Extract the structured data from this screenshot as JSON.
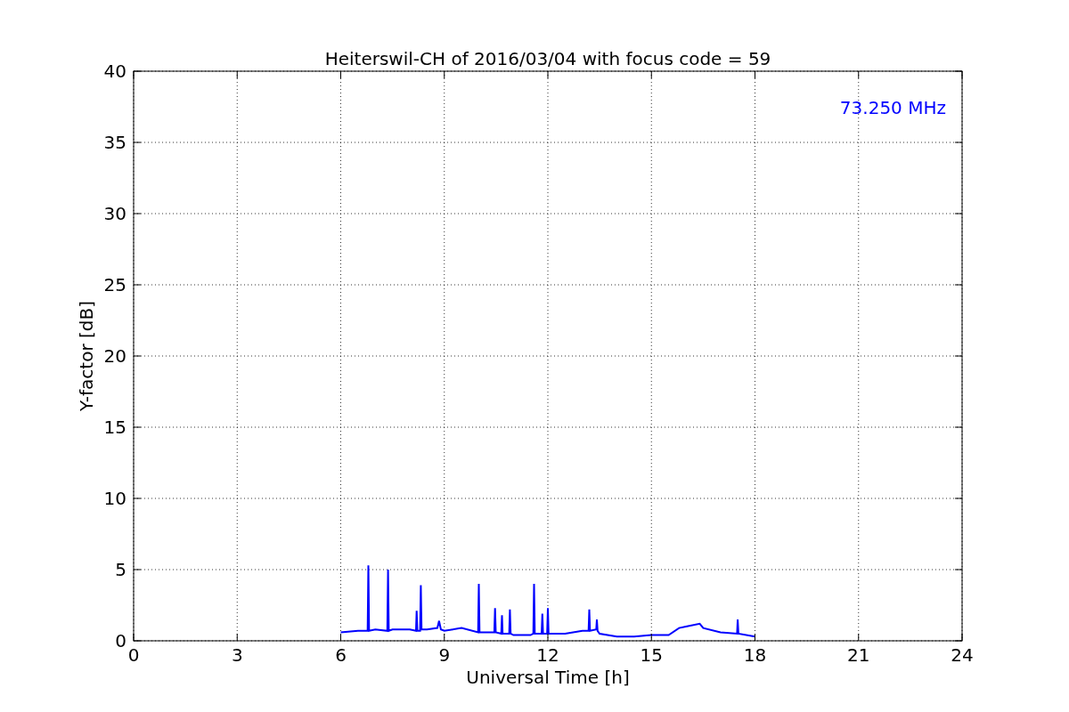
{
  "chart_data": {
    "type": "line",
    "title": "Heiterswil-CH of 2016/03/04 with focus code = 59",
    "xlabel": "Universal Time [h]",
    "ylabel": "Y-factor [dB]",
    "x": [
      6,
      6.5,
      6.78,
      6.8,
      6.82,
      7,
      7.35,
      7.37,
      7.39,
      7.5,
      8,
      8.18,
      8.2,
      8.22,
      8.3,
      8.32,
      8.34,
      8.5,
      8.8,
      8.85,
      8.9,
      9,
      9.5,
      9.98,
      10,
      10.02,
      10.45,
      10.47,
      10.49,
      10.65,
      10.67,
      10.69,
      10.88,
      10.9,
      10.92,
      11,
      11.5,
      11.58,
      11.6,
      11.62,
      11.82,
      11.84,
      11.86,
      11.98,
      12,
      12.02,
      12.5,
      13,
      13.18,
      13.2,
      13.22,
      13.4,
      13.42,
      13.44,
      13.5,
      14,
      14.5,
      15,
      15.5,
      15.8,
      16,
      16.4,
      16.5,
      17,
      17.48,
      17.5,
      17.52,
      18
    ],
    "series": [
      {
        "name": "73.250 MHz",
        "color": "#0000ff",
        "values": [
          0.6,
          0.7,
          0.7,
          5.3,
          0.7,
          0.8,
          0.7,
          5.0,
          0.7,
          0.8,
          0.8,
          0.7,
          2.1,
          0.7,
          0.7,
          3.9,
          0.8,
          0.8,
          0.9,
          1.4,
          0.8,
          0.7,
          0.9,
          0.6,
          4.0,
          0.6,
          0.6,
          2.3,
          0.6,
          0.5,
          1.8,
          0.5,
          0.5,
          2.2,
          0.5,
          0.4,
          0.4,
          0.5,
          4.0,
          0.5,
          0.5,
          1.9,
          0.5,
          0.5,
          2.3,
          0.5,
          0.5,
          0.7,
          0.7,
          2.2,
          0.7,
          0.8,
          1.5,
          0.7,
          0.5,
          0.3,
          0.3,
          0.4,
          0.4,
          0.9,
          1.0,
          1.2,
          0.9,
          0.6,
          0.5,
          1.5,
          0.5,
          0.3
        ]
      }
    ],
    "xlim": [
      0,
      24
    ],
    "ylim": [
      0,
      40
    ],
    "xticks": [
      0,
      3,
      6,
      9,
      12,
      15,
      18,
      21,
      24
    ],
    "yticks": [
      0,
      5,
      10,
      15,
      20,
      25,
      30,
      35,
      40
    ],
    "grid": true
  }
}
